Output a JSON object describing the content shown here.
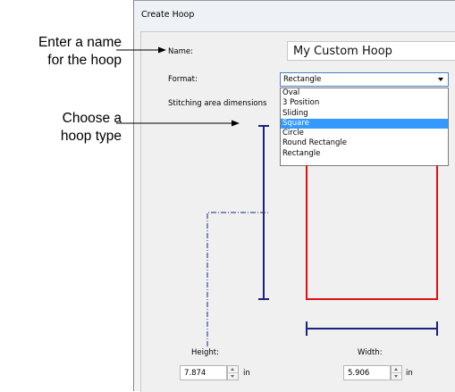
{
  "callouts": {
    "name_line1": "Enter a name",
    "name_line2": "for the hoop",
    "type_line1": "Choose a",
    "type_line2": "hoop type"
  },
  "dialog": {
    "title": "Create Hoop",
    "name_label": "Name:",
    "name_value": "My Custom Hoop",
    "format_label": "Format:",
    "format_selected": "Rectangle",
    "stitching_label": "Stitching area dimensions",
    "format_options": [
      "Oval",
      "3 Position",
      "Sliding",
      "Square",
      "Circle",
      "Round Rectangle",
      "Rectangle"
    ],
    "highlighted_option": "Square",
    "height_label": "Height:",
    "height_value": "7.874",
    "height_unit": "in",
    "width_label": "Width:",
    "width_value": "5.906",
    "width_unit": "in"
  },
  "colors": {
    "hoop_outline": "#e01010",
    "dimension_lines": "#1a237e",
    "selection": "#3399ff"
  }
}
